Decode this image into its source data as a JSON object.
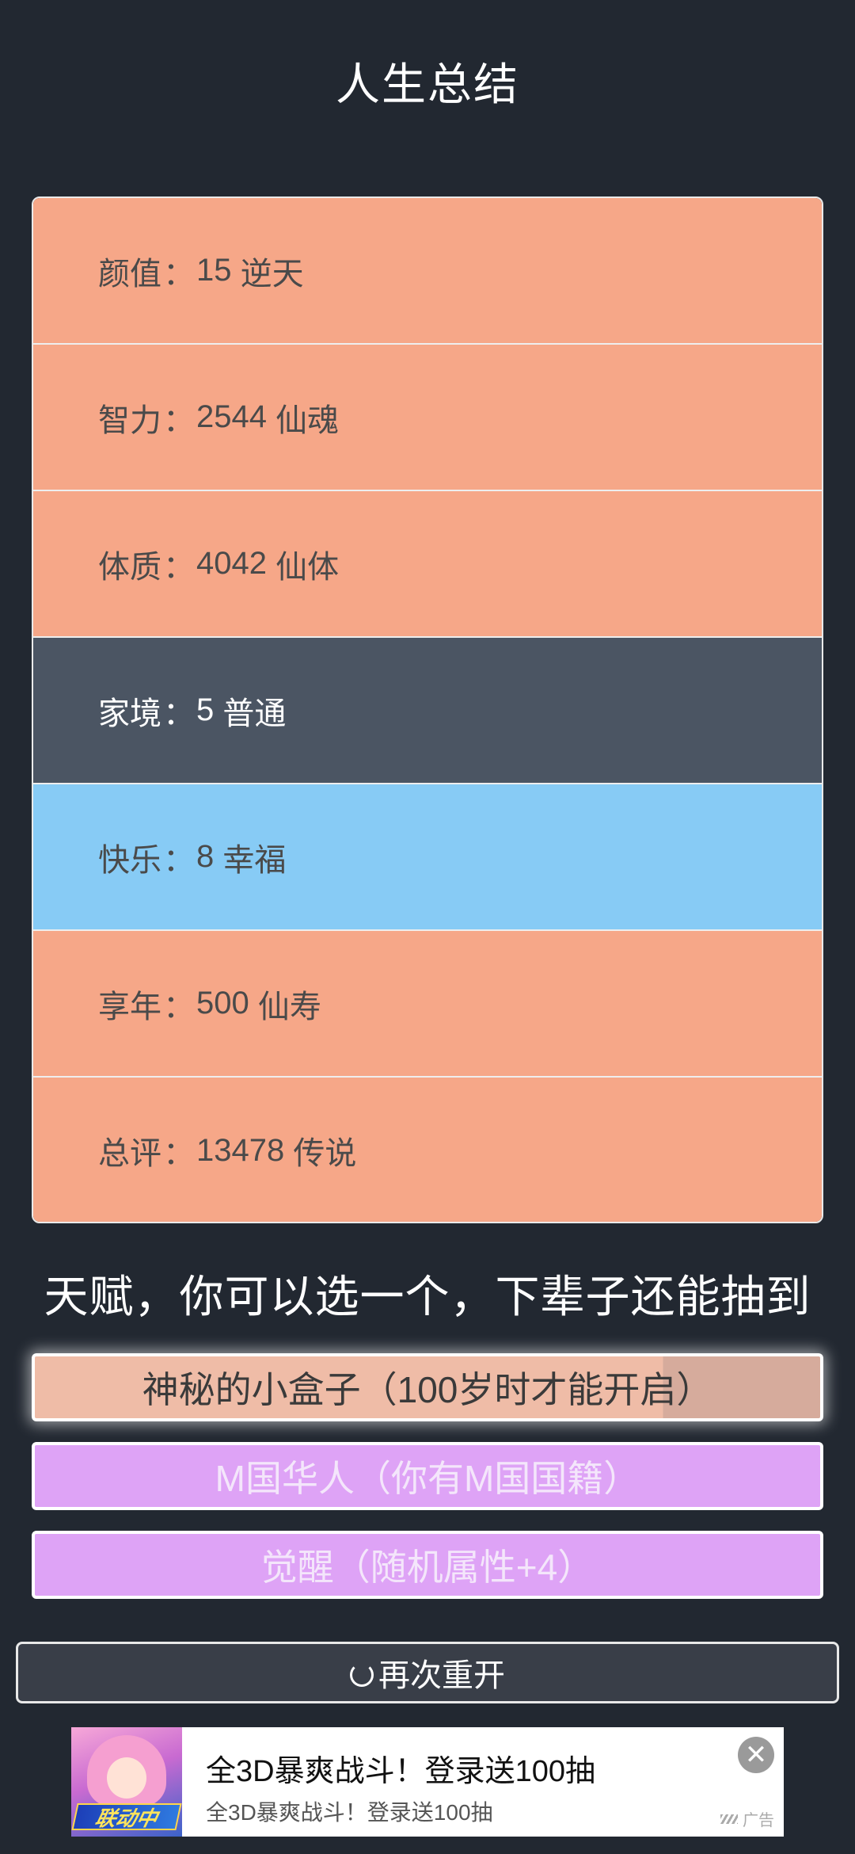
{
  "page": {
    "title": "人生总结"
  },
  "stats": [
    {
      "label": "颜值",
      "value": "15",
      "grade": "逆天"
    },
    {
      "label": "智力",
      "value": "2544",
      "grade": "仙魂"
    },
    {
      "label": "体质",
      "value": "4042",
      "grade": "仙体"
    },
    {
      "label": "家境",
      "value": "5",
      "grade": "普通"
    },
    {
      "label": "快乐",
      "value": "8",
      "grade": "幸福"
    },
    {
      "label": "享年",
      "value": "500",
      "grade": "仙寿"
    },
    {
      "label": "总评",
      "value": "13478",
      "grade": "传说"
    }
  ],
  "stat_separator": "：",
  "talents": {
    "heading": "天赋，你可以选一个，下辈子还能抽到",
    "items": [
      {
        "label": "神秘的小盒子（100岁时才能开启）"
      },
      {
        "label": "M国华人（你有M国国籍）"
      },
      {
        "label": "觉醒（随机属性+4）"
      }
    ]
  },
  "restart": {
    "label": "再次重开",
    "icon": "refresh-icon"
  },
  "ad": {
    "headline": "全3D暴爽战斗！登录送100抽",
    "subline": "全3D暴爽战斗！登录送100抽",
    "badge": "联动中",
    "label": "广告",
    "close_icon": "close-icon"
  },
  "colors": {
    "background": "#222831",
    "stat_legendary": "#f6a788",
    "stat_common": "#4b5563",
    "stat_good": "#87cbf5",
    "talent_purple": "#dea3f6",
    "talent_selected": "#efbca7"
  }
}
